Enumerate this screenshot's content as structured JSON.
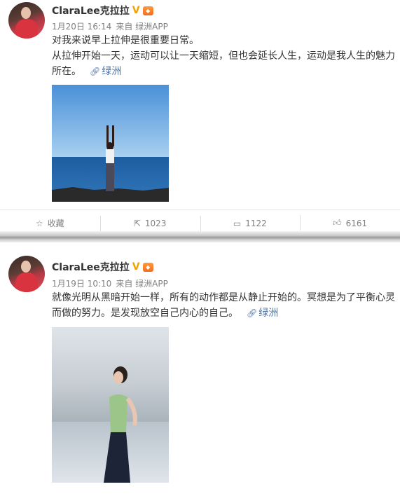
{
  "posts": [
    {
      "user": "ClaraLee克拉拉",
      "date": "1月20日 16:14",
      "source": "来自 绿洲APP",
      "text_line1": "对我来说早上拉伸是很重要日常。",
      "text_line2": "从拉伸开始一天，运动可以让一天缩短，但也会延长人生，运动是我人生的魅力所在。",
      "oasis_label": "绿洲",
      "actions": {
        "fav": "收藏",
        "repost": "1023",
        "comment": "1122",
        "like": "6161"
      }
    },
    {
      "user": "ClaraLee克拉拉",
      "date": "1月19日 10:10",
      "source": "来自 绿洲APP",
      "text_line1": "就像光明从黑暗开始一样，所有的动作都是从静止开始的。冥想是为了平衡心灵而做的努力。是发现放空自己内心的自己。",
      "oasis_label": "绿洲"
    }
  ],
  "icons": {
    "verified": "verified-v-icon",
    "level": "user-level-icon",
    "link": "link-icon",
    "star": "star-icon",
    "repost": "repost-icon",
    "comment": "comment-icon",
    "like": "thumbs-up-icon"
  },
  "colors": {
    "link": "#4d75a8",
    "verified": "#f2a100"
  }
}
